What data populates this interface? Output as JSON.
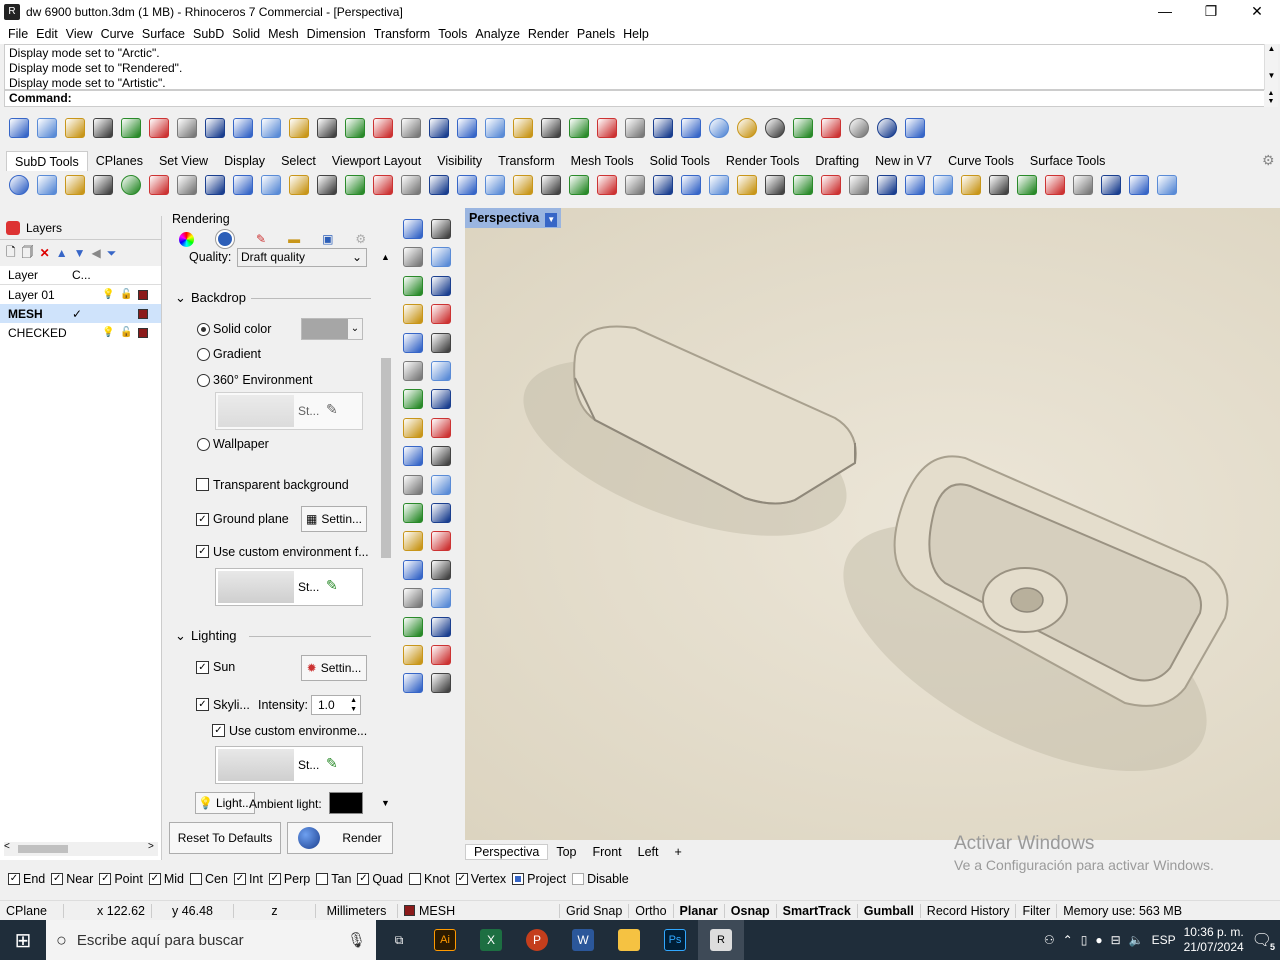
{
  "window": {
    "title": "dw 6900 button.3dm (1 MB) - Rhinoceros 7 Commercial - [Perspectiva]",
    "minimize": "—",
    "maximize": "❐",
    "close": "✕"
  },
  "menu": [
    "File",
    "Edit",
    "View",
    "Curve",
    "Surface",
    "SubD",
    "Solid",
    "Mesh",
    "Dimension",
    "Transform",
    "Tools",
    "Analyze",
    "Render",
    "Panels",
    "Help"
  ],
  "command_history": [
    "Display mode set to \"Arctic\".",
    "Display mode set to \"Rendered\".",
    "Display mode set to \"Artistic\"."
  ],
  "command_label": "Command:",
  "toolbar_tabs": [
    "SubD Tools",
    "CPlanes",
    "Set View",
    "Display",
    "Select",
    "Viewport Layout",
    "Visibility",
    "Transform",
    "Mesh Tools",
    "Solid Tools",
    "Render Tools",
    "Drafting",
    "New in V7",
    "Curve Tools",
    "Surface Tools"
  ],
  "std_icons": [
    "new-icon",
    "open-icon",
    "save-icon",
    "print-icon",
    "import-icon",
    "cut-icon",
    "copy-icon",
    "paste-icon",
    "undo-icon",
    "pan-icon",
    "rotate-view-icon",
    "zoom-icon",
    "zoom-window-icon",
    "zoom-extents-icon",
    "zoom-selected-icon",
    "rotate-icon",
    "four-views-icon",
    "car-icon",
    "car-ghost-icon",
    "cplane-icon",
    "grid-icon",
    "light-icon",
    "lock-icon",
    "layer-icon",
    "color-wheel-icon",
    "sphere-icon",
    "sphere-gray-icon",
    "sphere-blue-icon",
    "render-icon",
    "settings-icon",
    "gumball-icon",
    "globe-icon",
    "help-icon"
  ],
  "subd_icons": [
    "subd-sphere-icon",
    "subd-box-icon",
    "subd-cone-icon",
    "subd-cylinder-icon",
    "subd-ball-icon",
    "subd-ellipsoid-icon",
    "subd-torus-icon",
    "subd-cube-icon",
    "subd-loft1-icon",
    "subd-loft2-icon",
    "subd-sweep-icon",
    "subd-tube-icon",
    "subd-bridge-icon",
    "subd-crease-icon",
    "subd-bevel-icon",
    "subd-extrude-icon",
    "subd-face-icon",
    "subd-box2-icon",
    "subd-patch-icon",
    "subd-merge-icon",
    "subd-fill-icon",
    "subd-weld-icon",
    "subd-mesh-icon",
    "subd-cup-icon",
    "subd-align-icon",
    "subd-symmetry-icon",
    "subd-slide-icon",
    "subd-knife-icon",
    "subd-shell-icon",
    "subd-stitch-icon",
    "subd-insert-icon",
    "subd-grid-icon",
    "subd-list-icon",
    "subd-tools-icon",
    "subd-convert-icon",
    "subd-box3-icon",
    "subd-tag-icon",
    "subd-pipe-icon",
    "subd-wire-icon",
    "subd-hammer-icon",
    "subd-cplane-icon",
    "more-icon"
  ],
  "layers": {
    "tab": "Layers",
    "col_layer": "Layer",
    "col_current": "C...",
    "rows": [
      {
        "name": "Layer 01",
        "check": "",
        "selected": false
      },
      {
        "name": "MESH",
        "check": "✓",
        "selected": true
      },
      {
        "name": "CHECKED",
        "check": "",
        "selected": false
      }
    ]
  },
  "rendering": {
    "title": "Rendering",
    "quality_label": "Quality:",
    "quality_value": "Draft quality",
    "backdrop": "Backdrop",
    "solid_color": "Solid color",
    "gradient": "Gradient",
    "environment360": "360° Environment",
    "env_value": "St...",
    "wallpaper": "Wallpaper",
    "transparent_bg": "Transparent background",
    "ground_plane": "Ground plane",
    "settings": "Settin...",
    "use_custom_env": "Use custom environment f...",
    "lighting": "Lighting",
    "sun": "Sun",
    "skylight": "Skyli...",
    "intensity_label": "Intensity:",
    "intensity_value": "1.0",
    "use_custom_env2": "Use custom environme...",
    "light_btn": "Light...",
    "ambient_label": "Ambient light:",
    "reset": "Reset To Defaults",
    "render": "Render"
  },
  "viewport": {
    "title": "Perspectiva",
    "tabs": [
      "Perspectiva",
      "Top",
      "Front",
      "Left"
    ],
    "add_tab": "+"
  },
  "watermark": {
    "line1": "Activar Windows",
    "line2": "Ve a Configuración para activar Windows."
  },
  "osnaps": [
    {
      "label": "End",
      "checked": true
    },
    {
      "label": "Near",
      "checked": true
    },
    {
      "label": "Point",
      "checked": true
    },
    {
      "label": "Mid",
      "checked": true
    },
    {
      "label": "Cen",
      "checked": false
    },
    {
      "label": "Int",
      "checked": true
    },
    {
      "label": "Perp",
      "checked": true
    },
    {
      "label": "Tan",
      "checked": false
    },
    {
      "label": "Quad",
      "checked": true
    },
    {
      "label": "Knot",
      "checked": false
    },
    {
      "label": "Vertex",
      "checked": true
    },
    {
      "label": "Project",
      "checked": true
    },
    {
      "label": "Disable",
      "checked": false
    }
  ],
  "status": {
    "cplane": "CPlane",
    "x": "x 122.62",
    "y": "y 46.48",
    "z": "z",
    "units": "Millimeters",
    "layer": "MESH",
    "grid_snap": "Grid Snap",
    "ortho": "Ortho",
    "planar": "Planar",
    "osnap": "Osnap",
    "smarttrack": "SmartTrack",
    "gumball": "Gumball",
    "record_history": "Record History",
    "filter": "Filter",
    "memory": "Memory use: 563 MB"
  },
  "taskbar": {
    "search_placeholder": "Escribe aquí para buscar",
    "lang": "ESP",
    "time": "10:36 p. m.",
    "date": "21/07/2024",
    "notifications": "5"
  },
  "colors": {
    "accent": "#9ab5e0",
    "layer_red": "#8b1a1a",
    "taskbar": "#1f2d3a"
  }
}
